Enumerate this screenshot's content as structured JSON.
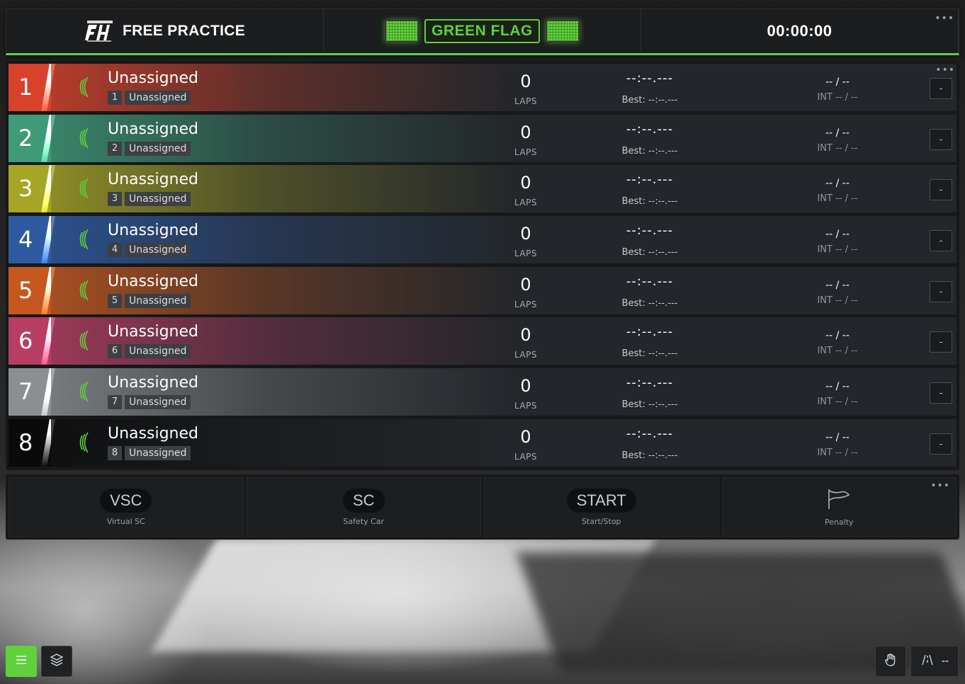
{
  "header": {
    "title": "FREE PRACTICE",
    "flag_label": "GREEN FLAG",
    "clock": "00:00:00",
    "menu_dots": "•••"
  },
  "list": {
    "menu_dots": "•••",
    "rows": [
      {
        "pos": "1",
        "driver": "Unassigned",
        "car_num": "1",
        "car_name": "Unassigned",
        "laps": "0",
        "laps_label": "LAPS",
        "time": "--:--.---",
        "best": "Best: --:--.---",
        "gap": "-- / --",
        "int": "INT -- / --",
        "action": "-",
        "color": "#d8412a"
      },
      {
        "pos": "2",
        "driver": "Unassigned",
        "car_num": "2",
        "car_name": "Unassigned",
        "laps": "0",
        "laps_label": "LAPS",
        "time": "--:--.---",
        "best": "Best: --:--.---",
        "gap": "-- / --",
        "int": "INT -- / --",
        "action": "-",
        "color": "#3f9a78"
      },
      {
        "pos": "3",
        "driver": "Unassigned",
        "car_num": "3",
        "car_name": "Unassigned",
        "laps": "0",
        "laps_label": "LAPS",
        "time": "--:--.---",
        "best": "Best: --:--.---",
        "gap": "-- / --",
        "int": "INT -- / --",
        "action": "-",
        "color": "#a6a526"
      },
      {
        "pos": "4",
        "driver": "Unassigned",
        "car_num": "4",
        "car_name": "Unassigned",
        "laps": "0",
        "laps_label": "LAPS",
        "time": "--:--.---",
        "best": "Best: --:--.---",
        "gap": "-- / --",
        "int": "INT -- / --",
        "action": "-",
        "color": "#2e5aa2"
      },
      {
        "pos": "5",
        "driver": "Unassigned",
        "car_num": "5",
        "car_name": "Unassigned",
        "laps": "0",
        "laps_label": "LAPS",
        "time": "--:--.---",
        "best": "Best: --:--.---",
        "gap": "-- / --",
        "int": "INT -- / --",
        "action": "-",
        "color": "#c6581f"
      },
      {
        "pos": "6",
        "driver": "Unassigned",
        "car_num": "6",
        "car_name": "Unassigned",
        "laps": "0",
        "laps_label": "LAPS",
        "time": "--:--.---",
        "best": "Best: --:--.---",
        "gap": "-- / --",
        "int": "INT -- / --",
        "action": "-",
        "color": "#b83d63"
      },
      {
        "pos": "7",
        "driver": "Unassigned",
        "car_num": "7",
        "car_name": "Unassigned",
        "laps": "0",
        "laps_label": "LAPS",
        "time": "--:--.---",
        "best": "Best: --:--.---",
        "gap": "-- / --",
        "int": "INT -- / --",
        "action": "-",
        "color": "#8c8f92"
      },
      {
        "pos": "8",
        "driver": "Unassigned",
        "car_num": "8",
        "car_name": "Unassigned",
        "laps": "0",
        "laps_label": "LAPS",
        "time": "--:--.---",
        "best": "Best: --:--.---",
        "gap": "-- / --",
        "int": "INT -- / --",
        "action": "-",
        "color": "#0a0a0a"
      }
    ]
  },
  "controls": {
    "menu_dots": "•••",
    "vsc_label": "VSC",
    "vsc_sub": "Virtual SC",
    "sc_label": "SC",
    "sc_sub": "Safety Car",
    "start_label": "START",
    "start_sub": "Start/Stop",
    "penalty_sub": "Penalty"
  },
  "bottom": {
    "mode_text": "--"
  },
  "icons": {
    "signal": "signal-icon",
    "menu": "hamburger-icon",
    "layers": "layers-icon",
    "hand": "hand-icon",
    "road": "road-icon",
    "flag": "flag-icon"
  },
  "colors": {
    "accent": "#5fd13a"
  }
}
